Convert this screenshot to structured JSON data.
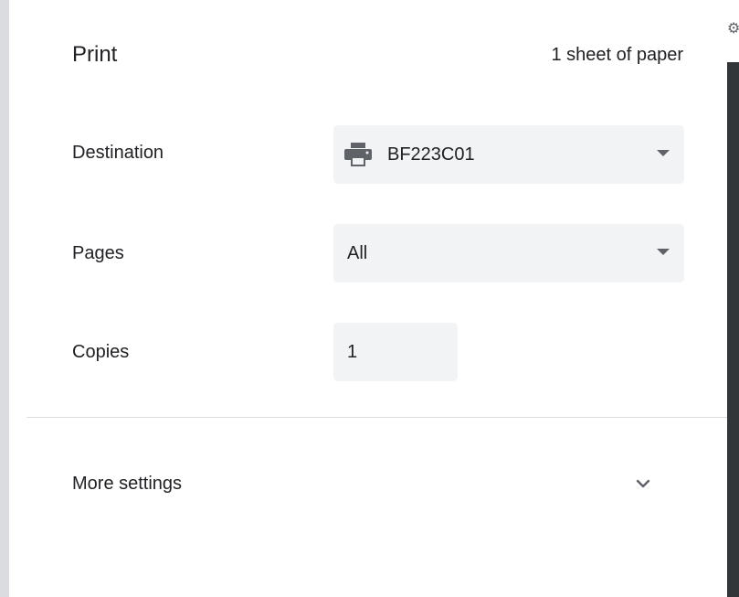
{
  "header": {
    "title": "Print",
    "sheet_count": "1 sheet of paper"
  },
  "destination": {
    "label": "Destination",
    "value": "BF223C01",
    "icon": "printer-icon"
  },
  "pages": {
    "label": "Pages",
    "value": "All"
  },
  "copies": {
    "label": "Copies",
    "value": "1"
  },
  "more_settings": {
    "label": "More settings",
    "icon": "chevron-down-icon"
  },
  "colors": {
    "field_bg": "#f1f3f4",
    "text": "#202124",
    "icon": "#5f6368",
    "divider": "#dadce0",
    "preview_bg": "#323639"
  }
}
